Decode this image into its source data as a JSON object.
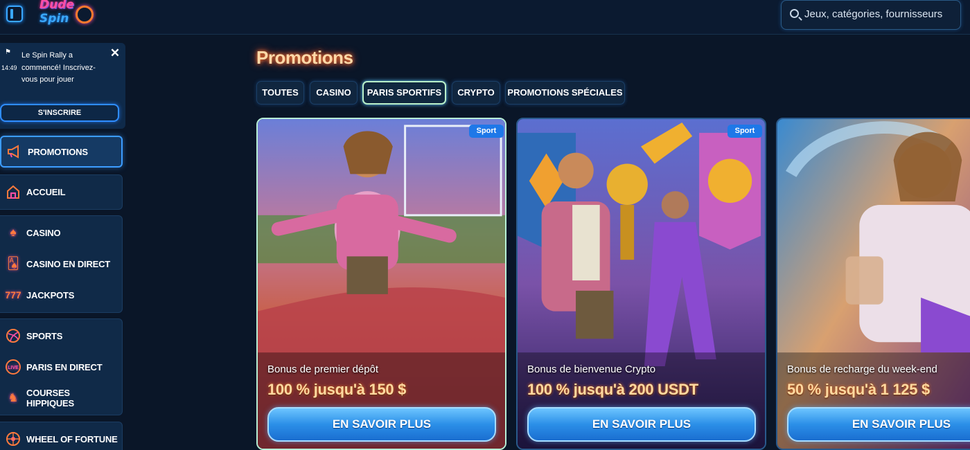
{
  "header": {
    "logo_line1": "Dude",
    "logo_line2": "Spin",
    "search_placeholder": "Jeux, catégories, fournisseurs"
  },
  "notification": {
    "time": "14:49",
    "message": "Le Spin Rally a commencé! Inscrivez-vous pour jouer",
    "signup_label": "S'INSCRIRE"
  },
  "sidebar": {
    "items": [
      {
        "label": "PROMOTIONS",
        "icon": "megaphone-icon"
      },
      {
        "label": "ACCUEIL",
        "icon": "home-icon"
      },
      {
        "label": "CASINO",
        "icon": "spade-icon"
      },
      {
        "label": "CASINO EN DIRECT",
        "icon": "cards-icon"
      },
      {
        "label": "JACKPOTS",
        "icon": "777-icon"
      },
      {
        "label": "SPORTS",
        "icon": "ball-icon"
      },
      {
        "label": "PARIS EN DIRECT",
        "icon": "live-icon"
      },
      {
        "label": "COURSES HIPPIQUES",
        "icon": "horse-icon"
      },
      {
        "label": "WHEEL OF FORTUNE",
        "icon": "wheel-icon"
      }
    ]
  },
  "main": {
    "title": "Promotions",
    "tabs": [
      {
        "label": "TOUTES"
      },
      {
        "label": "CASINO"
      },
      {
        "label": "PARIS SPORTIFS"
      },
      {
        "label": "CRYPTO"
      },
      {
        "label": "PROMOTIONS SPÉCIALES"
      }
    ],
    "active_tab": "PARIS SPORTIFS",
    "cards": [
      {
        "badge": "Sport",
        "subtitle": "Bonus de premier dépôt",
        "amount": "100 % jusqu'à 150 $",
        "button": "EN SAVOIR PLUS"
      },
      {
        "badge": "Sport",
        "subtitle": "Bonus de bienvenue Crypto",
        "amount": "100 % jusqu'à 200 USDT",
        "button": "EN SAVOIR PLUS"
      },
      {
        "badge": "",
        "subtitle": "Bonus de recharge du week-end",
        "amount": "50 % jusqu'à 1 125 $",
        "button": "EN SAVOIR PLUS"
      }
    ]
  },
  "colors": {
    "background": "#0a1628",
    "accent_blue": "#2f8dff",
    "title_orange": "#ffd9a8"
  }
}
